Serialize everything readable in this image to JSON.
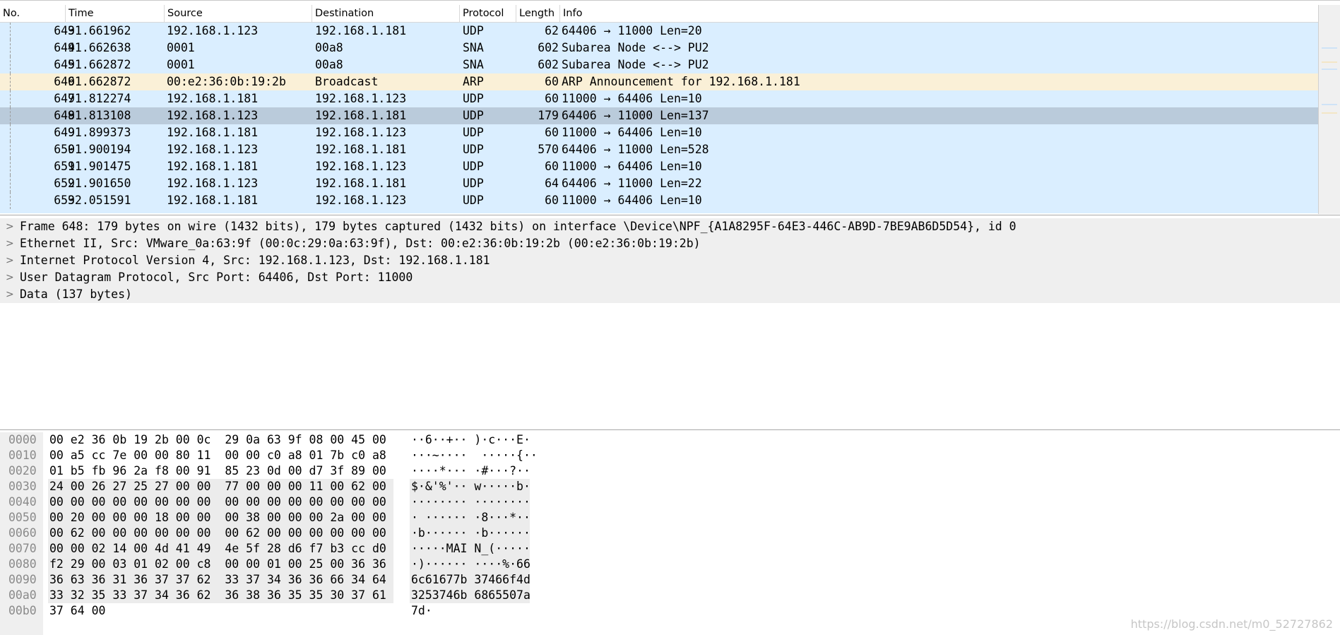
{
  "packet_list": {
    "columns": [
      "No.",
      "Time",
      "Source",
      "Destination",
      "Protocol",
      "Length",
      "Info"
    ],
    "rows": [
      {
        "no": "643",
        "time": "91.661962",
        "src": "192.168.1.123",
        "dst": "192.168.1.181",
        "proto": "UDP",
        "len": "62",
        "info": "64406 → 11000 Len=20",
        "kind": "udp"
      },
      {
        "no": "644",
        "time": "91.662638",
        "src": "0001",
        "dst": "00a8",
        "proto": "SNA",
        "len": "602",
        "info": "Subarea Node <--> PU2",
        "kind": "udp"
      },
      {
        "no": "645",
        "time": "91.662872",
        "src": "0001",
        "dst": "00a8",
        "proto": "SNA",
        "len": "602",
        "info": "Subarea Node <--> PU2",
        "kind": "udp"
      },
      {
        "no": "646",
        "time": "91.662872",
        "src": "00:e2:36:0b:19:2b",
        "dst": "Broadcast",
        "proto": "ARP",
        "len": "60",
        "info": "ARP Announcement for 192.168.1.181",
        "kind": "arp"
      },
      {
        "no": "647",
        "time": "91.812274",
        "src": "192.168.1.181",
        "dst": "192.168.1.123",
        "proto": "UDP",
        "len": "60",
        "info": "11000 → 64406 Len=10",
        "kind": "udp"
      },
      {
        "no": "648",
        "time": "91.813108",
        "src": "192.168.1.123",
        "dst": "192.168.1.181",
        "proto": "UDP",
        "len": "179",
        "info": "64406 → 11000 Len=137",
        "kind": "selected"
      },
      {
        "no": "649",
        "time": "91.899373",
        "src": "192.168.1.181",
        "dst": "192.168.1.123",
        "proto": "UDP",
        "len": "60",
        "info": "11000 → 64406 Len=10",
        "kind": "udp"
      },
      {
        "no": "650",
        "time": "91.900194",
        "src": "192.168.1.123",
        "dst": "192.168.1.181",
        "proto": "UDP",
        "len": "570",
        "info": "64406 → 11000 Len=528",
        "kind": "udp"
      },
      {
        "no": "651",
        "time": "91.901475",
        "src": "192.168.1.181",
        "dst": "192.168.1.123",
        "proto": "UDP",
        "len": "60",
        "info": "11000 → 64406 Len=10",
        "kind": "udp"
      },
      {
        "no": "652",
        "time": "91.901650",
        "src": "192.168.1.123",
        "dst": "192.168.1.181",
        "proto": "UDP",
        "len": "64",
        "info": "64406 → 11000 Len=22",
        "kind": "udp"
      },
      {
        "no": "653",
        "time": "92.051591",
        "src": "192.168.1.181",
        "dst": "192.168.1.123",
        "proto": "UDP",
        "len": "60",
        "info": "11000 → 64406 Len=10",
        "kind": "udp"
      }
    ]
  },
  "details": [
    {
      "arrow": ">",
      "text": "Frame 648: 179 bytes on wire (1432 bits), 179 bytes captured (1432 bits) on interface \\Device\\NPF_{A1A8295F-64E3-446C-AB9D-7BE9AB6D5D54}, id 0"
    },
    {
      "arrow": ">",
      "text": "Ethernet II, Src: VMware_0a:63:9f (00:0c:29:0a:63:9f), Dst: 00:e2:36:0b:19:2b (00:e2:36:0b:19:2b)"
    },
    {
      "arrow": ">",
      "text": "Internet Protocol Version 4, Src: 192.168.1.123, Dst: 192.168.1.181"
    },
    {
      "arrow": ">",
      "text": "User Datagram Protocol, Src Port: 64406, Dst Port: 11000"
    },
    {
      "arrow": ">",
      "text": "Data (137 bytes)"
    }
  ],
  "bytes": [
    {
      "offset": "0000",
      "hex": "00 e2 36 0b 19 2b 00 0c  29 0a 63 9f 08 00 45 00",
      "ascii": "··6··+·· )·c···E·"
    },
    {
      "offset": "0010",
      "hex": "00 a5 cc 7e 00 00 80 11  00 00 c0 a8 01 7b c0 a8",
      "ascii": "···~····  ·····{··"
    },
    {
      "offset": "0020",
      "hex": "01 b5 fb 96 2a f8 00 91  85 23 0d 00 d7 3f 89 00",
      "ascii": "····*··· ·#···?··"
    },
    {
      "offset": "0030",
      "hex": "24 00 26 27 25 27 00 00  77 00 00 00 11 00 62 00",
      "ascii": "$·&'%'·· w·····b·"
    },
    {
      "offset": "0040",
      "hex": "00 00 00 00 00 00 00 00  00 00 00 00 00 00 00 00",
      "ascii": "········ ········"
    },
    {
      "offset": "0050",
      "hex": "00 20 00 00 00 18 00 00  00 38 00 00 00 2a 00 00",
      "ascii": "· ······ ·8···*··"
    },
    {
      "offset": "0060",
      "hex": "00 62 00 00 00 00 00 00  00 62 00 00 00 00 00 00",
      "ascii": "·b······ ·b······"
    },
    {
      "offset": "0070",
      "hex": "00 00 02 14 00 4d 41 49  4e 5f 28 d6 f7 b3 cc d0",
      "ascii": "·····MAI N_(·····"
    },
    {
      "offset": "0080",
      "hex": "f2 29 00 03 01 02 00 c8  00 00 01 00 25 00 36 36",
      "ascii": "·)······ ····%·66"
    },
    {
      "offset": "0090",
      "hex": "36 63 36 31 36 37 37 62  33 37 34 36 36 66 34 64",
      "ascii": "6c61677b 37466f4d"
    },
    {
      "offset": "00a0",
      "hex": "33 32 35 33 37 34 36 62  36 38 36 35 35 30 37 61",
      "ascii": "3253746b 6865507a"
    },
    {
      "offset": "00b0",
      "hex": "37 64 00",
      "ascii": "7d·"
    }
  ],
  "watermark": "https://blog.csdn.net/m0_52727862",
  "colors": {
    "udp_row": "#daeeff",
    "arp_row": "#faf0d7",
    "selected_row": "#bacbdb",
    "detail_bg": "#efefef"
  }
}
